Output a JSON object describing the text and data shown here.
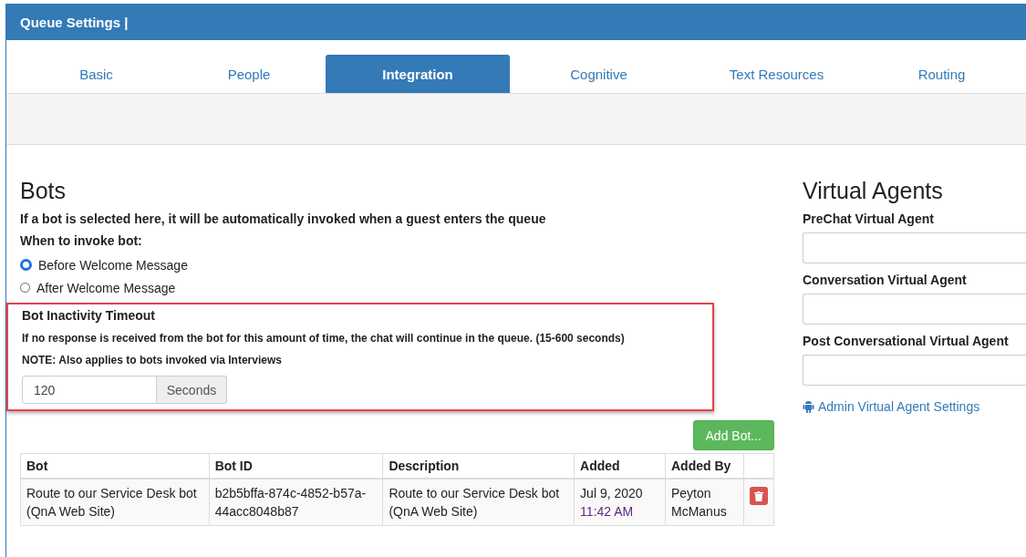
{
  "window": {
    "title": "Queue Settings |"
  },
  "tabs": [
    {
      "label": "Basic",
      "selected": false
    },
    {
      "label": "People",
      "selected": false
    },
    {
      "label": "Integration",
      "selected": true
    },
    {
      "label": "Cognitive",
      "selected": false
    },
    {
      "label": "Text Resources",
      "selected": false
    },
    {
      "label": "Routing",
      "selected": false
    }
  ],
  "bots": {
    "heading": "Bots",
    "description": "If a bot is selected here, it will be automatically invoked when a guest enters the queue",
    "invoke_label": "When to invoke bot:",
    "options": [
      {
        "label": "Before Welcome Message",
        "selected": true
      },
      {
        "label": "After Welcome Message",
        "selected": false
      }
    ],
    "timeout": {
      "title": "Bot Inactivity Timeout",
      "text": "If no response is received from the bot for this amount of time, the chat will continue in the queue. (15-600 seconds)",
      "note": "NOTE: Also applies to bots invoked via Interviews",
      "value": "120",
      "unit": "Seconds"
    },
    "add_button": "Add Bot...",
    "table": {
      "columns": [
        "Bot",
        "Bot ID",
        "Description",
        "Added",
        "Added By"
      ],
      "rows": [
        {
          "bot": "Route to our Service Desk bot (QnA Web Site)",
          "bot_id": "b2b5bffa-874c-4852-b57a-44acc8048b87",
          "description": "Route to our Service Desk bot (QnA Web Site)",
          "added_date": "Jul 9, 2020",
          "added_time": "11:42 AM",
          "added_by": "Peyton McManus"
        }
      ]
    }
  },
  "virtual_agents": {
    "heading": "Virtual Agents",
    "fields": [
      {
        "label": "PreChat Virtual Agent"
      },
      {
        "label": "Conversation Virtual Agent"
      },
      {
        "label": "Post Conversational Virtual Agent"
      }
    ],
    "link": "Admin Virtual Agent Settings"
  }
}
